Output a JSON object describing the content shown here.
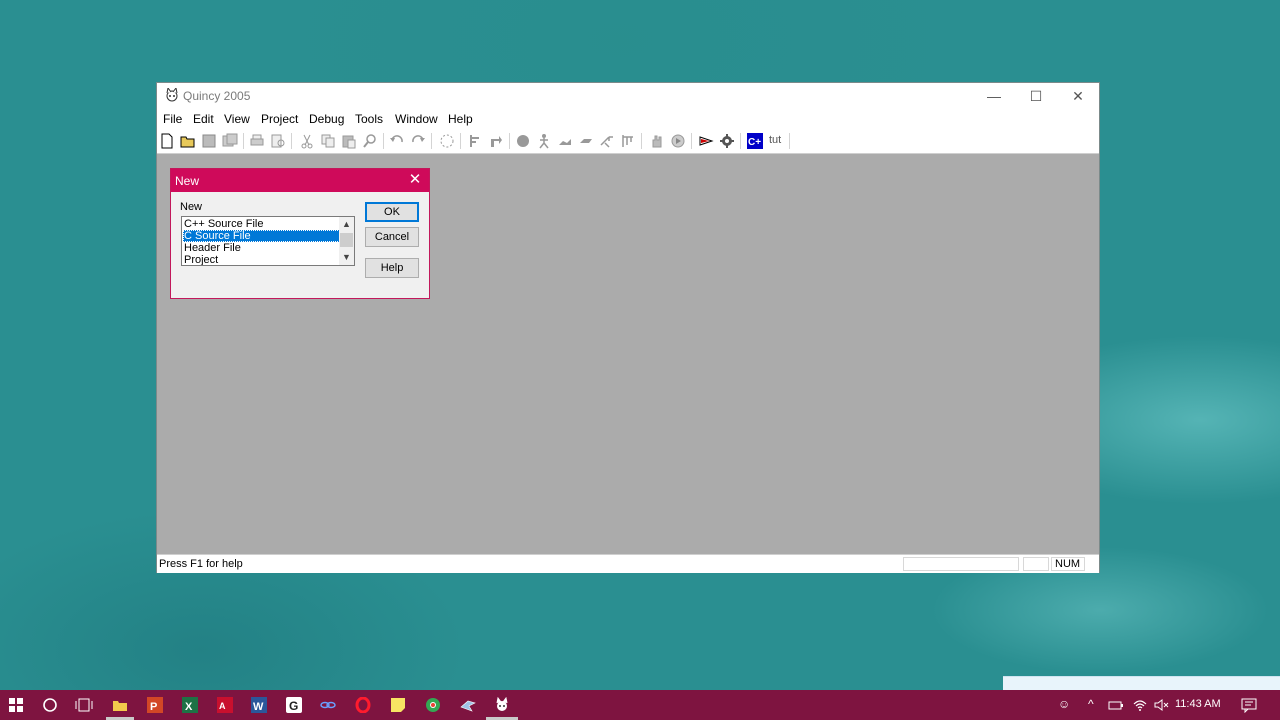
{
  "window": {
    "title": "Quincy 2005",
    "controls": {
      "minimize": "—",
      "maximize": "☐",
      "close": "✕"
    },
    "menu": [
      "File",
      "Edit",
      "View",
      "Project",
      "Debug",
      "Tools",
      "Window",
      "Help"
    ],
    "toolbar": {
      "icons": [
        "new-file-icon",
        "open-folder-icon",
        "save-icon",
        "save-all-icon",
        "print-icon",
        "print-preview-icon",
        "cut-icon",
        "copy-icon",
        "paste-icon",
        "find-icon",
        "undo-icon",
        "redo-icon",
        "build-all-icon",
        "step-icon",
        "step-into-icon",
        "breakpoint-icon",
        "run-icon",
        "step-over-icon",
        "step-out-icon",
        "watch-icon",
        "run-to-cursor-icon",
        "stop-icon",
        "hand-icon",
        "debug-run-icon",
        "compile-icon",
        "gear-icon",
        "cpp-icon"
      ],
      "tut_label": "tut"
    },
    "status": {
      "help_text": "Press F1 for help",
      "num": "NUM"
    }
  },
  "dialog": {
    "title": "New",
    "label": "New",
    "items": [
      "C++ Source File",
      "C Source File",
      "Header File",
      "Project"
    ],
    "selected_index": 1,
    "buttons": {
      "ok": "OK",
      "cancel": "Cancel",
      "help": "Help"
    }
  },
  "taskbar": {
    "apps": [
      "start-icon",
      "cortana-icon",
      "task-view-icon",
      "file-explorer-icon",
      "powerpoint-icon",
      "excel-icon",
      "acrobat-icon",
      "word-icon",
      "app-g-icon",
      "link-icon",
      "opera-icon",
      "sticky-notes-icon",
      "chrome-icon",
      "app-bird-icon",
      "quincy-icon"
    ],
    "clock": "11:43 AM",
    "colors": {
      "taskbar": "#7e1440",
      "dialog_title": "#cf0a5a",
      "selection": "#0078d7"
    }
  }
}
